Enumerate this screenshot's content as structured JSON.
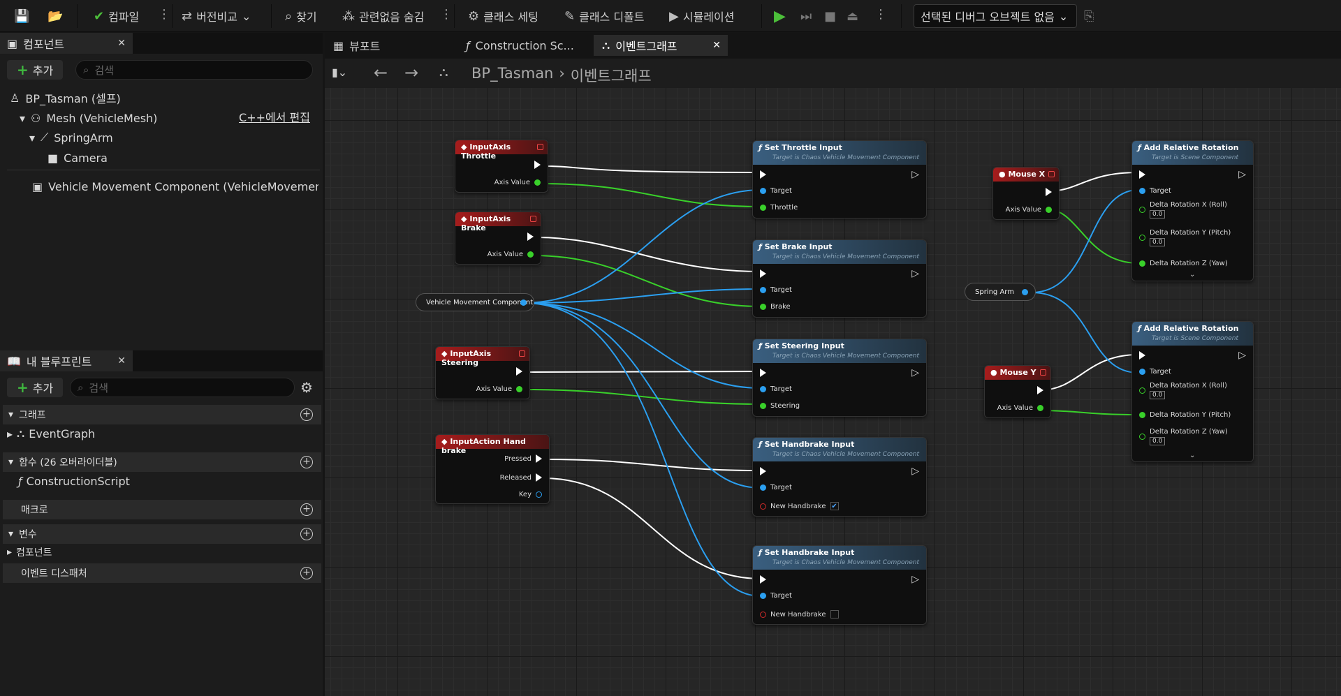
{
  "toolbar": {
    "compile": "컴파일",
    "diff": "버전비교",
    "find": "찾기",
    "hide_unrelated": "관련없음 숨김",
    "class_settings": "클래스 세팅",
    "class_defaults": "클래스 디폴트",
    "simulation": "시뮬레이션",
    "debug_object": "선택된 디버그 오브젝트 없음"
  },
  "components_panel": {
    "tab": "컴포넌트",
    "add": "추가",
    "search_placeholder": "검색",
    "tree": [
      "BP_Tasman (셀프)",
      "Mesh (VehicleMesh)",
      "SpringArm",
      "Camera",
      "Vehicle Movement Component (VehicleMovementComp"
    ],
    "edit_cpp": "C++에서 편집"
  },
  "blueprint_panel": {
    "tab": "내 블루프린트",
    "add": "추가",
    "search_placeholder": "검색",
    "graph_section": "그래프",
    "event_graph": "EventGraph",
    "functions_section": "함수 (26 오버라이더블)",
    "construction_script": "ConstructionScript",
    "macros_section": "매크로",
    "variables_section": "변수",
    "components_sub": "컴포넌트",
    "dispatchers_section": "이벤트 디스패처"
  },
  "doc_tabs": [
    "뷰포트",
    "Construction Sc...",
    "이벤트그래프"
  ],
  "breadcrumb": {
    "asset": "BP_Tasman",
    "graph": "이벤트그래프"
  },
  "nodes": {
    "throttle_event": "InputAxis Throttle",
    "brake_event": "InputAxis Brake",
    "steering_event": "InputAxis Steering",
    "handbrake_event": "InputAction Hand brake",
    "axis_value": "Axis Value",
    "pressed": "Pressed",
    "released": "Released",
    "key": "Key",
    "vmc_var": "Vehicle Movement Component",
    "spring_arm_var": "Spring Arm",
    "set_throttle": "Set Throttle Input",
    "set_brake": "Set Brake Input",
    "set_steering": "Set Steering Input",
    "set_handbrake": "Set Handbrake Input",
    "target_vmc": "Target is Chaos Vehicle Movement Component",
    "target": "Target",
    "throttle": "Throttle",
    "brake": "Brake",
    "steering": "Steering",
    "new_handbrake": "New Handbrake",
    "mouse_x": "Mouse X",
    "mouse_y": "Mouse Y",
    "add_rel_rot": "Add Relative Rotation",
    "target_scene": "Target is Scene Component",
    "roll": "Delta Rotation X (Roll)",
    "pitch": "Delta Rotation Y (Pitch)",
    "yaw": "Delta Rotation Z (Yaw)",
    "zero": "0.0"
  },
  "colors": {
    "exec": "#ffffff",
    "object": "#2b9ff0",
    "float": "#39d02a",
    "event_header": "#a61c1c",
    "function_header": "#3a5f80"
  }
}
